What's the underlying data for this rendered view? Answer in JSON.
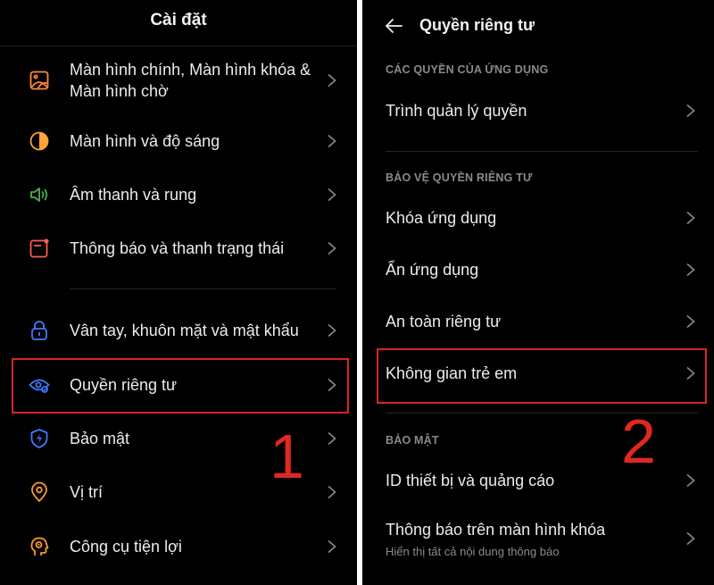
{
  "left_screen": {
    "title": "Cài đặt",
    "items": [
      {
        "label_line1": "Màn hình chính, Màn hình khóa &",
        "label_line2": "Màn hình chờ",
        "icon": "wallpaper-icon",
        "icon_color": "#ff8a3d"
      },
      {
        "label": "Màn hình và độ sáng",
        "icon": "brightness-icon",
        "icon_color": "#ffa23a"
      },
      {
        "label": "Âm thanh và rung",
        "icon": "speaker-icon",
        "icon_color": "#4cb050"
      },
      {
        "label": "Thông báo và thanh trạng thái",
        "icon": "notification-icon",
        "icon_color": "#ff5a4f"
      },
      {
        "label": "Vân tay, khuôn mặt và mật khẩu",
        "icon": "lock-icon",
        "icon_color": "#3e7bff"
      },
      {
        "label": "Quyền riêng tư",
        "icon": "privacy-eye-icon",
        "icon_color": "#3e7bff"
      },
      {
        "label": "Bảo mật",
        "icon": "shield-bolt-icon",
        "icon_color": "#3e7bff"
      },
      {
        "label": "Vị trí",
        "icon": "location-pin-icon",
        "icon_color": "#ff9a2e"
      },
      {
        "label": "Công cụ tiện lợi",
        "icon": "tools-head-icon",
        "icon_color": "#ff9a2e"
      }
    ],
    "step_number": "1"
  },
  "right_screen": {
    "title": "Quyền riêng tư",
    "sections": [
      {
        "header": "CÁC QUYỀN CỦA ỨNG DỤNG",
        "items": [
          "Trình quản lý quyền"
        ]
      },
      {
        "header": "BẢO VỆ QUYỀN RIÊNG TƯ",
        "items": [
          "Khóa ứng dụng",
          "Ẩn ứng dụng",
          "An toàn riêng tư",
          "Không gian trẻ em"
        ]
      },
      {
        "header": "BẢO MẬT",
        "items": [
          "ID thiết bị và quảng cáo",
          "Thông báo trên màn hình khóa"
        ]
      }
    ],
    "lockscreen_subtitle": "Hiển thị tất cả nội dung thông báo",
    "step_number": "2"
  },
  "colors": {
    "highlight": "#d9261c",
    "background": "#000000",
    "accent_blue": "#3e7bff"
  }
}
